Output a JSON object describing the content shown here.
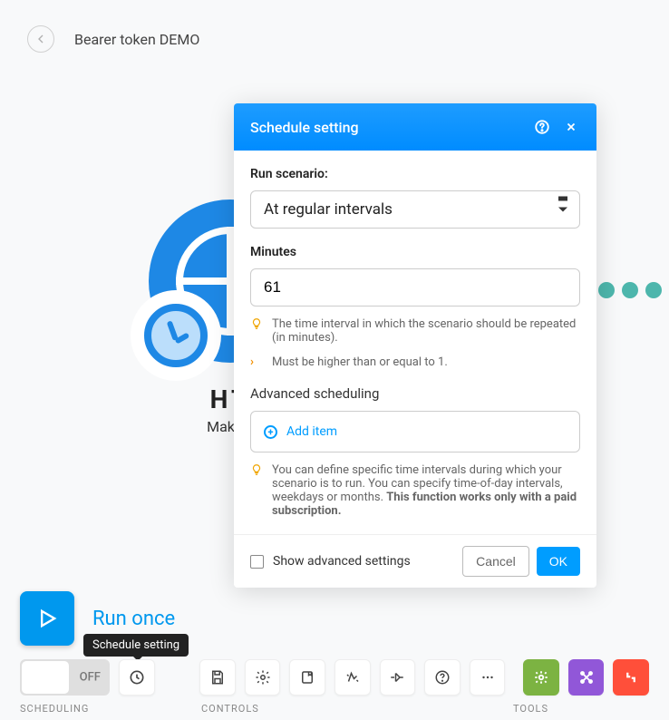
{
  "header": {
    "title": "Bearer token DEMO"
  },
  "node": {
    "title": "HT",
    "subtitle": "Make a"
  },
  "modal": {
    "title": "Schedule setting",
    "runScenarioLabel": "Run scenario:",
    "runScenarioValue": "At regular intervals",
    "minutesLabel": "Minutes",
    "minutesValue": "61",
    "intervalHint": "The time interval in which the scenario should be repeated (in minutes).",
    "constraint": "Must be higher than or equal to 1.",
    "advancedLabel": "Advanced scheduling",
    "addItem": "Add item",
    "advHintText": "You can define specific time intervals during which your scenario is to run. You can specify time-of-day intervals, weekdays or months. ",
    "advHintBold": "This function works only with a paid subscription.",
    "showAdvanced": "Show advanced settings",
    "cancel": "Cancel",
    "ok": "OK"
  },
  "tooltip": "Schedule setting",
  "run": {
    "label": "Run once"
  },
  "switch": {
    "state": "OFF"
  },
  "sections": {
    "scheduling": "SCHEDULING",
    "controls": "CONTROLS",
    "tools": "TOOLS"
  }
}
